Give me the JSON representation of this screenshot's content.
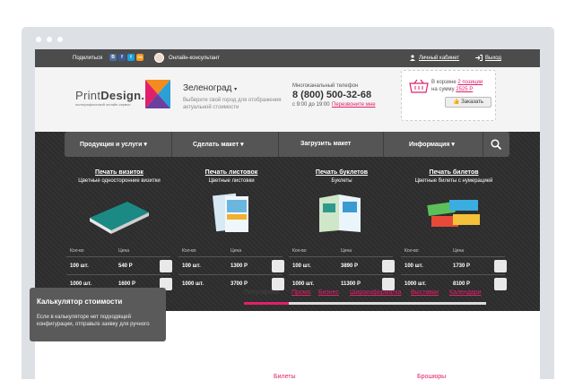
{
  "topbar": {
    "share_label": "Поделиться",
    "social": [
      {
        "icon": "vk-icon",
        "letter": "В",
        "color": "#4b6fa0"
      },
      {
        "icon": "facebook-icon",
        "letter": "f",
        "color": "#3b5998"
      },
      {
        "icon": "twitter-icon",
        "letter": "t",
        "color": "#1aa1da"
      },
      {
        "icon": "odnoklassniki-icon",
        "letter": "Ok",
        "color": "#f59a1d"
      }
    ],
    "consultant": "Онлайн-консультант",
    "cabinet": "Личный кабинет",
    "exit": "Выход"
  },
  "header": {
    "logo_print": "Print",
    "logo_design": "Design.ru",
    "logo_sub": "полиграфический онлайн-сервис",
    "city": "Зеленоград",
    "city_hint": "Выберите свой город для отображения актуальной стоимости",
    "phone_label": "Многоканальный телефон",
    "phone": "8 (800) 500-32-68",
    "hours": "с 9:00 до 19:00",
    "callback": "Перезвоните мне",
    "cart_line1": "В корзине",
    "cart_count": "2 позиции",
    "cart_line2": "на сумму",
    "cart_sum": "2525 Р",
    "order_button": "Заказать"
  },
  "nav": {
    "items": [
      "Продукция и услуги",
      "Сделать макет",
      "Загрузить макет",
      "Информация"
    ]
  },
  "products": [
    {
      "title": "Печать визиток",
      "subtitle": "Цветные односторонние визитки",
      "qty_header": "Кол-во",
      "price_header": "Цена",
      "rows": [
        {
          "qty": "100 шт.",
          "price": "540 Р"
        },
        {
          "qty": "1000 шт.",
          "price": "1600 Р"
        }
      ]
    },
    {
      "title": "Печать листовок",
      "subtitle": "Цветные листовки",
      "qty_header": "Кол-во",
      "price_header": "Цена",
      "rows": [
        {
          "qty": "100 шт.",
          "price": "1300 Р"
        },
        {
          "qty": "1000 шт.",
          "price": "3700 Р"
        }
      ]
    },
    {
      "title": "Печать буклетов",
      "subtitle": "Буклеты",
      "qty_header": "Кол-во",
      "price_header": "Цена",
      "rows": [
        {
          "qty": "100 шт.",
          "price": "3890 Р"
        },
        {
          "qty": "1000 шт.",
          "price": "11300 Р"
        }
      ]
    },
    {
      "title": "Печать билетов",
      "subtitle": "Цветные билеты с нумерацией",
      "qty_header": "Кол-во",
      "price_header": "Цена",
      "rows": [
        {
          "qty": "100 шт.",
          "price": "1730 Р"
        },
        {
          "qty": "1000 шт.",
          "price": "8100 Р"
        }
      ]
    }
  ],
  "calc": {
    "title": "Калькулятор стоимости",
    "desc": "Если в калькуляторе нет подходящей конфигурации, отправьте заявку для ручного"
  },
  "tabs": [
    "Популярное",
    "Промо",
    "Бизнес",
    "Широкоформатка",
    "Выставки",
    "Календари"
  ],
  "sections": [
    "Билеты",
    "Брошюры"
  ],
  "colors": {
    "accent": "#e2206a",
    "dark": "#2f2f2f",
    "nav": "#555555"
  }
}
